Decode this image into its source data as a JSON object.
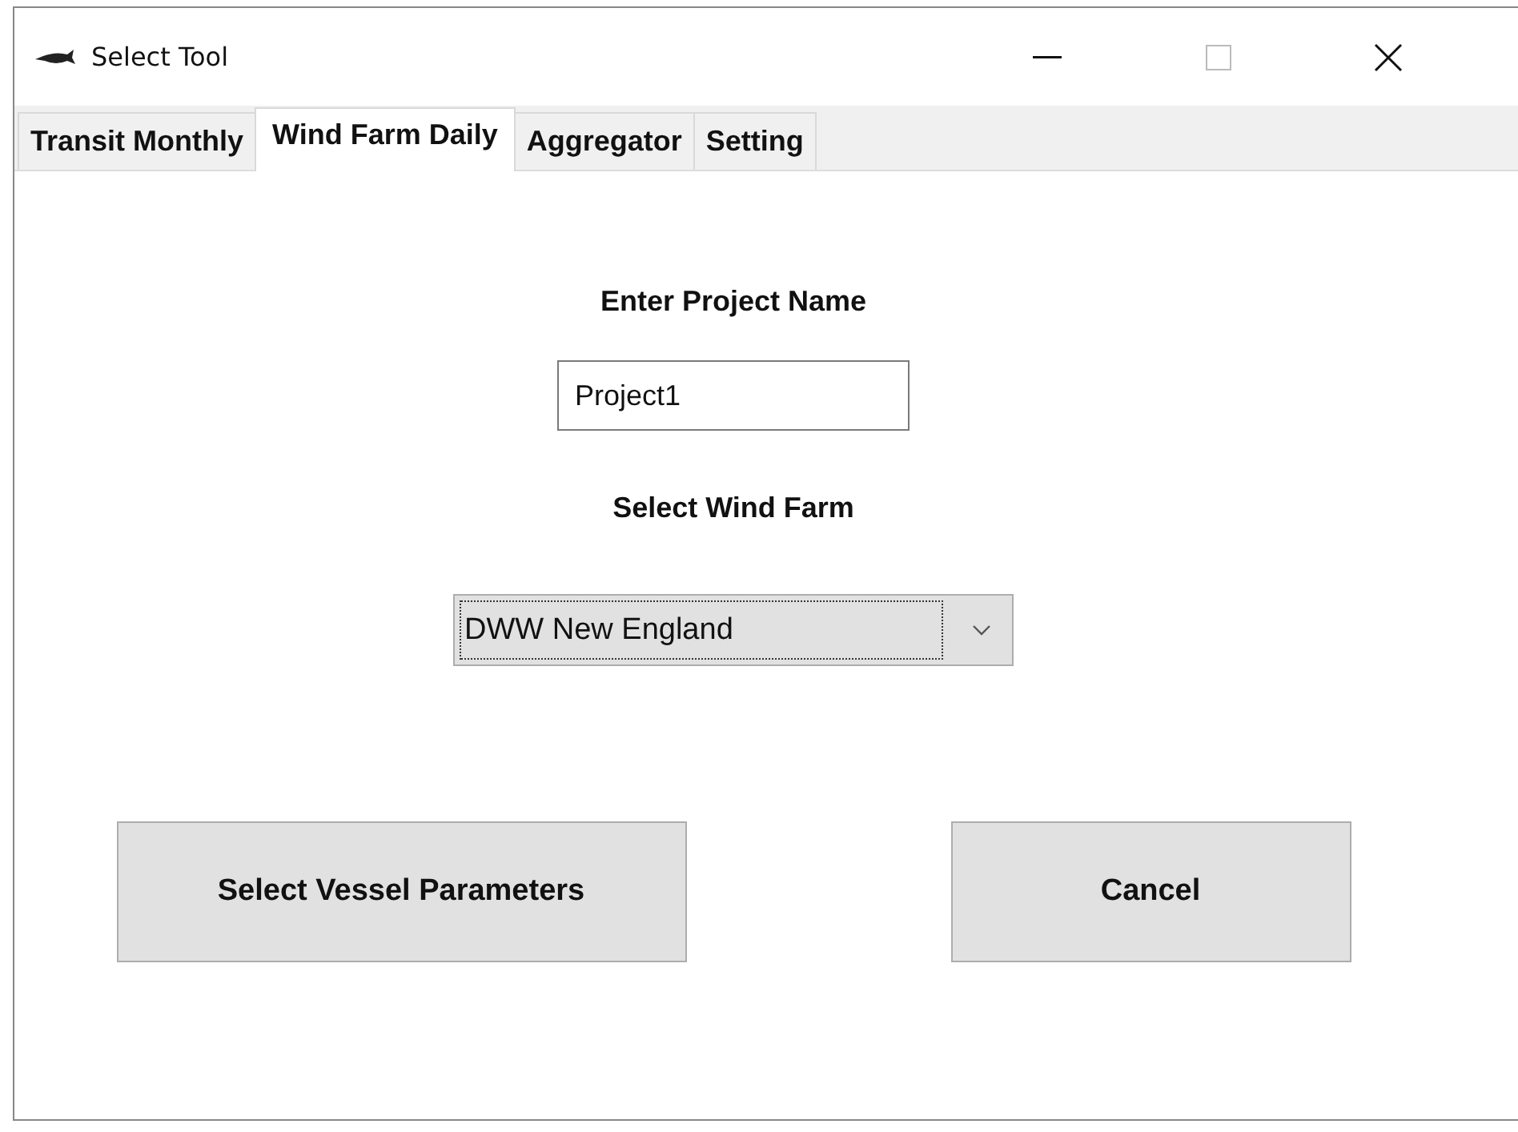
{
  "window": {
    "title": "Select Tool"
  },
  "tabs": [
    {
      "label": "Transit Monthly",
      "selected": false
    },
    {
      "label": "Wind Farm Daily",
      "selected": true
    },
    {
      "label": "Aggregator",
      "selected": false
    },
    {
      "label": "Setting",
      "selected": false
    }
  ],
  "project_name": {
    "label": "Enter Project Name",
    "value": "Project1"
  },
  "wind_farm": {
    "label": "Select Wind Farm",
    "value": "DWW New England"
  },
  "buttons": [
    "Select Vessel Parameters",
    "Cancel"
  ]
}
